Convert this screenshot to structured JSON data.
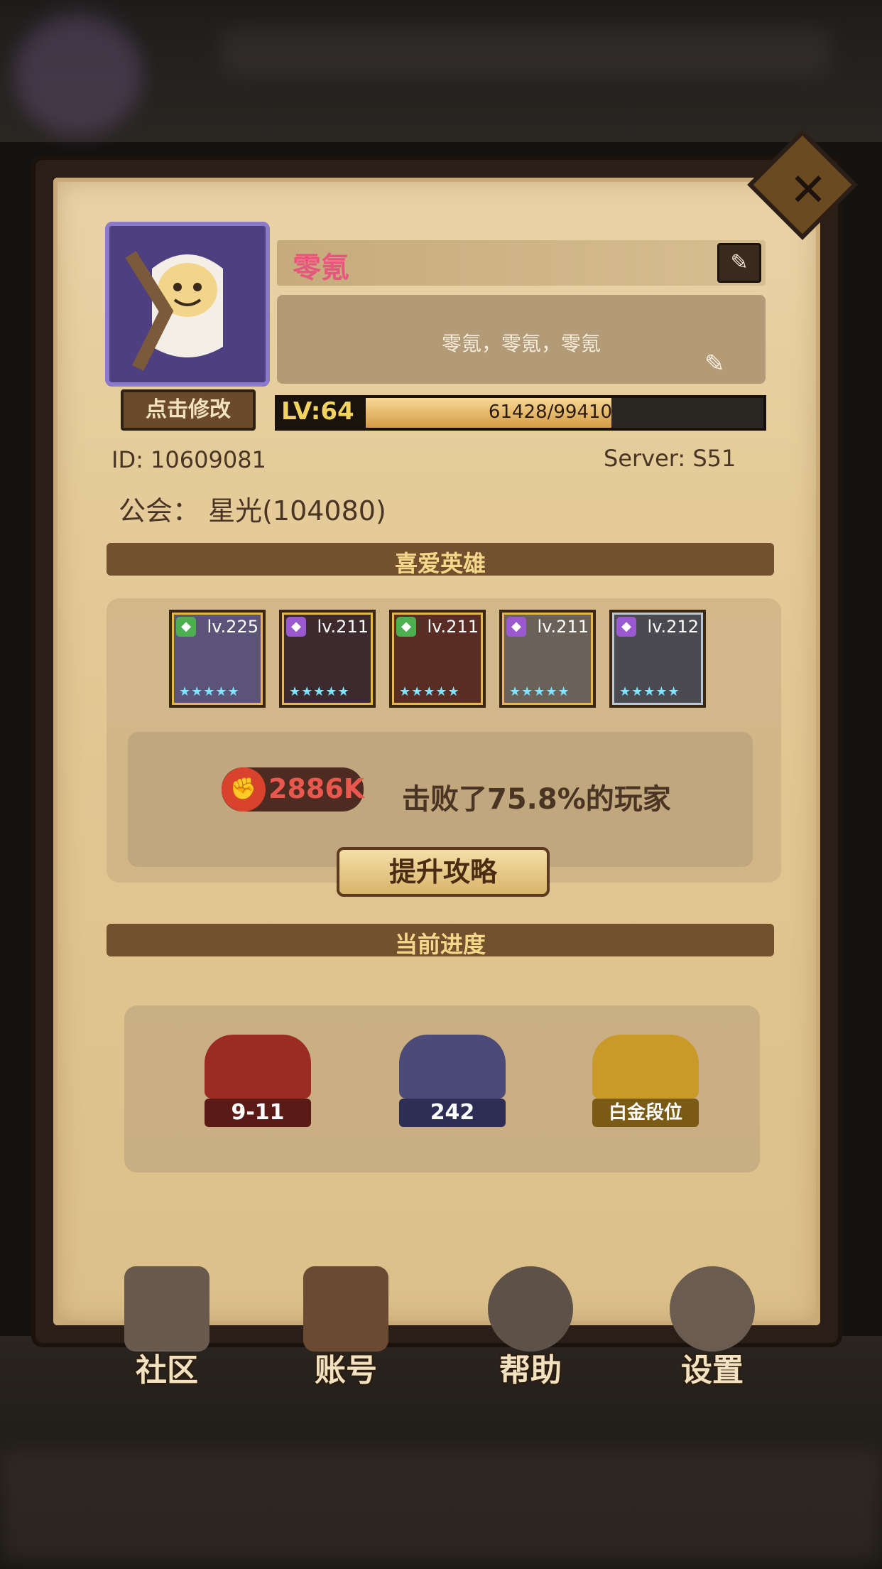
{
  "profile": {
    "name": "零氪",
    "signature": "零氪，零氪，零氪",
    "edit_avatar_label": "点击修改",
    "level_label": "LV:64",
    "exp_text": "61428/99410",
    "exp_progress": 0.618,
    "id_text": "ID:  10609081",
    "server_text": "Server:  S51",
    "guild_text": "公会：  星光(104080)"
  },
  "favorite_heroes": {
    "title": "喜爱英雄",
    "heroes": [
      {
        "level": "lv.225",
        "gem_color": "#4caf50",
        "portrait_color": "#5b5478",
        "stars": "★★★★★"
      },
      {
        "level": "lv.211",
        "gem_color": "#9b59d0",
        "portrait_color": "#3c2a2e",
        "stars": "★★★★★"
      },
      {
        "level": "lv.211",
        "gem_color": "#4caf50",
        "portrait_color": "#5a2d24",
        "stars": "★★★★★"
      },
      {
        "level": "lv.211",
        "gem_color": "#9b59d0",
        "portrait_color": "#6a6258",
        "stars": "★★★★★"
      },
      {
        "level": "lv.212",
        "gem_color": "#9b59d0",
        "portrait_color": "#4a4a50",
        "stars": "★★★★★"
      }
    ]
  },
  "power": {
    "value": "2886K",
    "beat_text": "击败了75.8%的玩家",
    "strategy_button": "提升攻略"
  },
  "progress": {
    "title": "当前进度",
    "items": [
      {
        "label": "9-11",
        "color": "#9b2c24"
      },
      {
        "label": "242",
        "color": "#4b4a78"
      },
      {
        "label": "白金段位",
        "color": "#c99a2a"
      }
    ]
  },
  "bottom_nav": [
    {
      "label": "社区",
      "icon": "castle-icon"
    },
    {
      "label": "账号",
      "icon": "account-card-icon"
    },
    {
      "label": "帮助",
      "icon": "chat-bubble-icon"
    },
    {
      "label": "设置",
      "icon": "gear-icon"
    }
  ]
}
